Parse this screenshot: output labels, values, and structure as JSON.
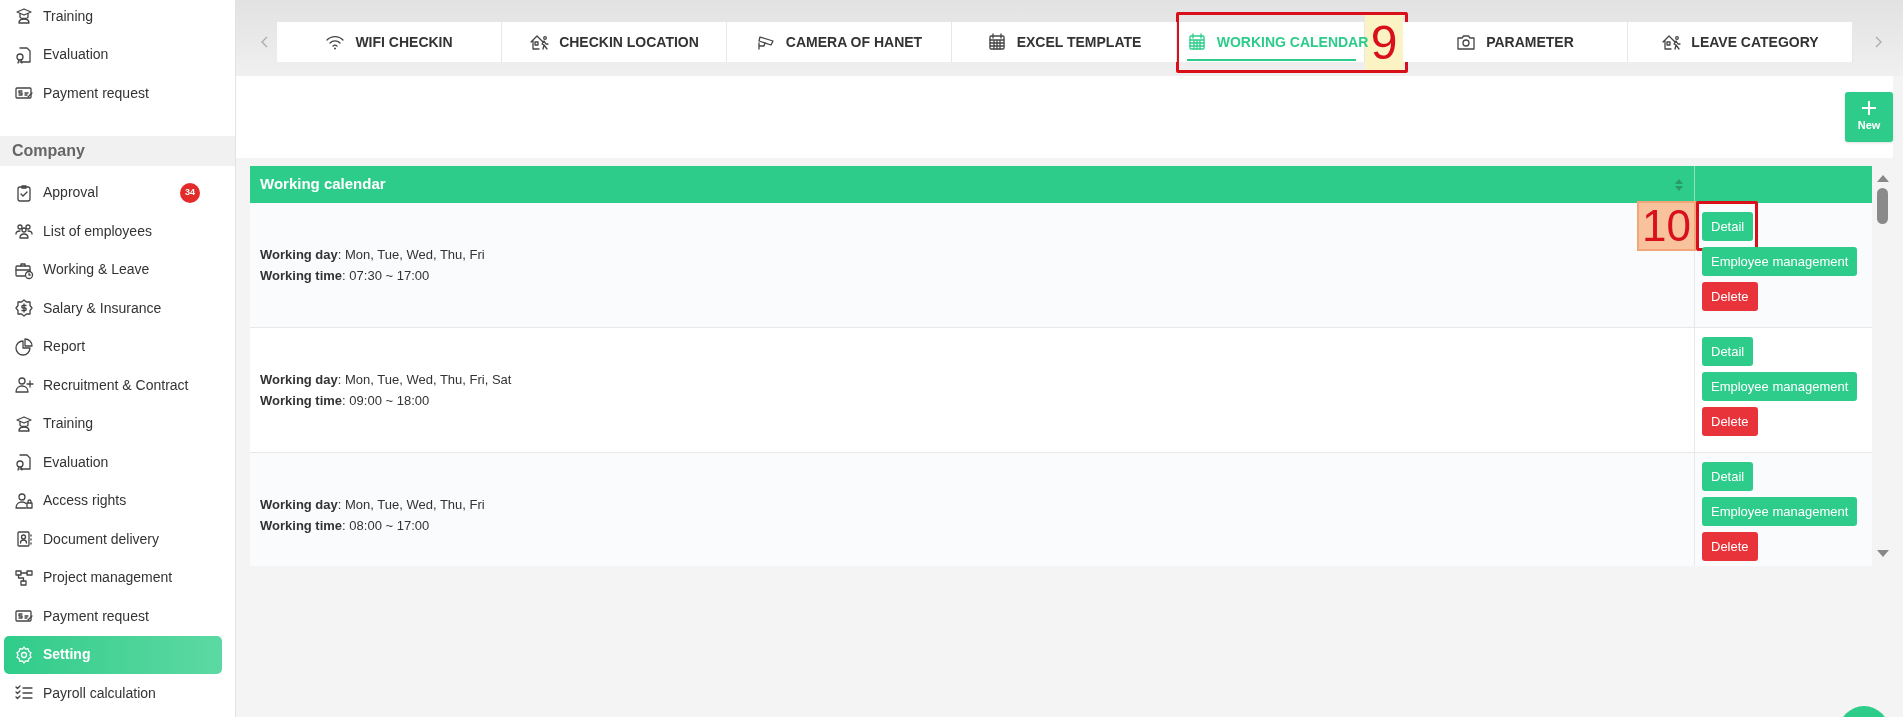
{
  "sidebar": {
    "top_items": [
      {
        "label": "Training",
        "selected": false
      },
      {
        "label": "Evaluation",
        "selected": false
      },
      {
        "label": "Payment request",
        "selected": false
      }
    ],
    "section": {
      "title": "Company",
      "items": [
        {
          "label": "Approval",
          "badge": "34",
          "selected": false
        },
        {
          "label": "List of employees",
          "selected": false
        },
        {
          "label": "Working & Leave",
          "selected": false
        },
        {
          "label": "Salary & Insurance",
          "selected": false
        },
        {
          "label": "Report",
          "selected": false
        },
        {
          "label": "Recruitment & Contract",
          "selected": false
        },
        {
          "label": "Training",
          "selected": false
        },
        {
          "label": "Evaluation",
          "selected": false
        },
        {
          "label": "Access rights",
          "selected": false
        },
        {
          "label": "Document delivery",
          "selected": false
        },
        {
          "label": "Project management",
          "selected": false
        },
        {
          "label": "Payment request",
          "selected": false
        },
        {
          "label": "Setting",
          "selected": true
        },
        {
          "label": "Payroll calculation",
          "selected": false
        }
      ]
    }
  },
  "tabs": [
    {
      "label": "WIFI CHECKIN",
      "selected": false
    },
    {
      "label": "CHECKIN LOCATION",
      "selected": false
    },
    {
      "label": "CAMERA OF HANET",
      "selected": false
    },
    {
      "label": "EXCEL TEMPLATE",
      "selected": false
    },
    {
      "label": "WORKING CALENDAR",
      "selected": true,
      "annotation": "9"
    },
    {
      "label": "PARAMETER",
      "selected": false
    },
    {
      "label": "LEAVE CATEGORY",
      "selected": false
    }
  ],
  "toolbar": {
    "new_button": "New"
  },
  "table": {
    "columns": [
      {
        "label": "Working calendar",
        "sortable": true
      }
    ],
    "rows": [
      {
        "lines": [
          "**Working day**: Mon, Tue, Wed, Thu, Fri",
          "**Working time**: 07:30 ~ 17:00"
        ],
        "actions": [
          {
            "label": "Detail",
            "kind": "primary",
            "annotation": "10"
          },
          {
            "label": "Employee management",
            "kind": "primary"
          },
          {
            "label": "Delete",
            "kind": "danger"
          }
        ]
      },
      {
        "lines": [
          "**Working day**: Mon, Tue, Wed, Thu, Fri, Sat",
          "**Working time**: 09:00 ~ 18:00"
        ],
        "actions": [
          {
            "label": "Detail",
            "kind": "primary"
          },
          {
            "label": "Employee management",
            "kind": "primary"
          },
          {
            "label": "Delete",
            "kind": "danger"
          }
        ]
      },
      {
        "lines": [
          "**Working day**: Mon, Tue, Wed, Thu, Fri",
          "**Working time**: 08:00 ~ 17:00"
        ],
        "actions": [
          {
            "label": "Detail",
            "kind": "primary"
          },
          {
            "label": "Employee management",
            "kind": "primary"
          },
          {
            "label": "Delete",
            "kind": "danger"
          }
        ]
      }
    ]
  }
}
